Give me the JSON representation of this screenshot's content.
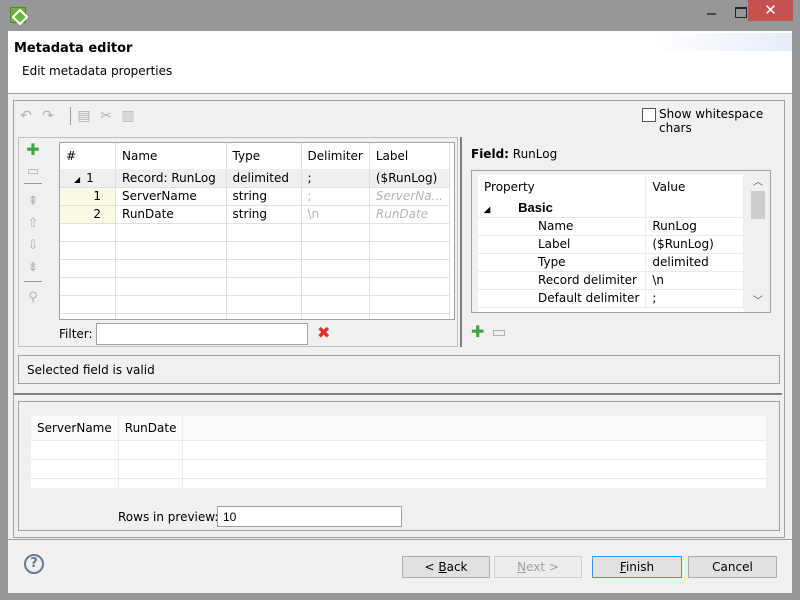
{
  "window": {
    "title": "",
    "icon": "cloverdx-icon",
    "controls": {
      "minimize": "minimize-icon",
      "maximize": "maximize-icon",
      "close": "✕"
    }
  },
  "header": {
    "title": "Metadata editor",
    "subtitle": "Edit metadata properties"
  },
  "toolbar": {
    "icons": [
      "undo-icon",
      "redo-icon",
      "copy-icon",
      "cut-icon",
      "paste-icon"
    ],
    "show_whitespace": {
      "label": "Show whitespace chars",
      "checked": false
    }
  },
  "side_buttons": [
    "add-field-icon",
    "remove-field-icon",
    "move-top-icon",
    "move-up-icon",
    "move-down-icon",
    "move-bottom-icon",
    "extract-icon"
  ],
  "fields_table": {
    "columns": [
      "#",
      "Name",
      "Type",
      "Delimiter",
      "Label"
    ],
    "record": {
      "num": "1",
      "name": "Record: RunLog",
      "type": "delimited",
      "delimiter": ";",
      "label": "($RunLog)"
    },
    "rows": [
      {
        "num": "1",
        "name": "ServerName",
        "type": "string",
        "delimiter": ";",
        "label": "ServerNa..."
      },
      {
        "num": "2",
        "name": "RunDate",
        "type": "string",
        "delimiter": "\\n",
        "label": "RunDate"
      }
    ]
  },
  "filter": {
    "label": "Filter:",
    "value": ""
  },
  "field_panel": {
    "title_prefix": "Field:",
    "title_value": "RunLog",
    "columns": [
      "Property",
      "Value"
    ],
    "group": "Basic",
    "properties": [
      {
        "name": "Name",
        "value": "RunLog"
      },
      {
        "name": "Label",
        "value": "($RunLog)"
      },
      {
        "name": "Type",
        "value": "delimited"
      },
      {
        "name": "Record delimiter",
        "value": "\\n"
      },
      {
        "name": "Default delimiter",
        "value": ";"
      }
    ]
  },
  "status": {
    "text": "Selected field is valid"
  },
  "preview": {
    "columns": [
      "ServerName",
      "RunDate"
    ],
    "rows_label": "Rows in preview:",
    "rows_value": "10"
  },
  "footer": {
    "back": {
      "prefix": "< ",
      "mnemonic": "B",
      "rest": "ack"
    },
    "next": {
      "mnemonic": "N",
      "rest": "ext >"
    },
    "finish": {
      "mnemonic": "F",
      "rest": "inish"
    },
    "cancel": "Cancel",
    "help": "?"
  },
  "colors": {
    "close_button": "#c75050",
    "add_icon": "#3fa63f",
    "clear_icon": "#e03030",
    "default_button_border": "#3399ff"
  }
}
